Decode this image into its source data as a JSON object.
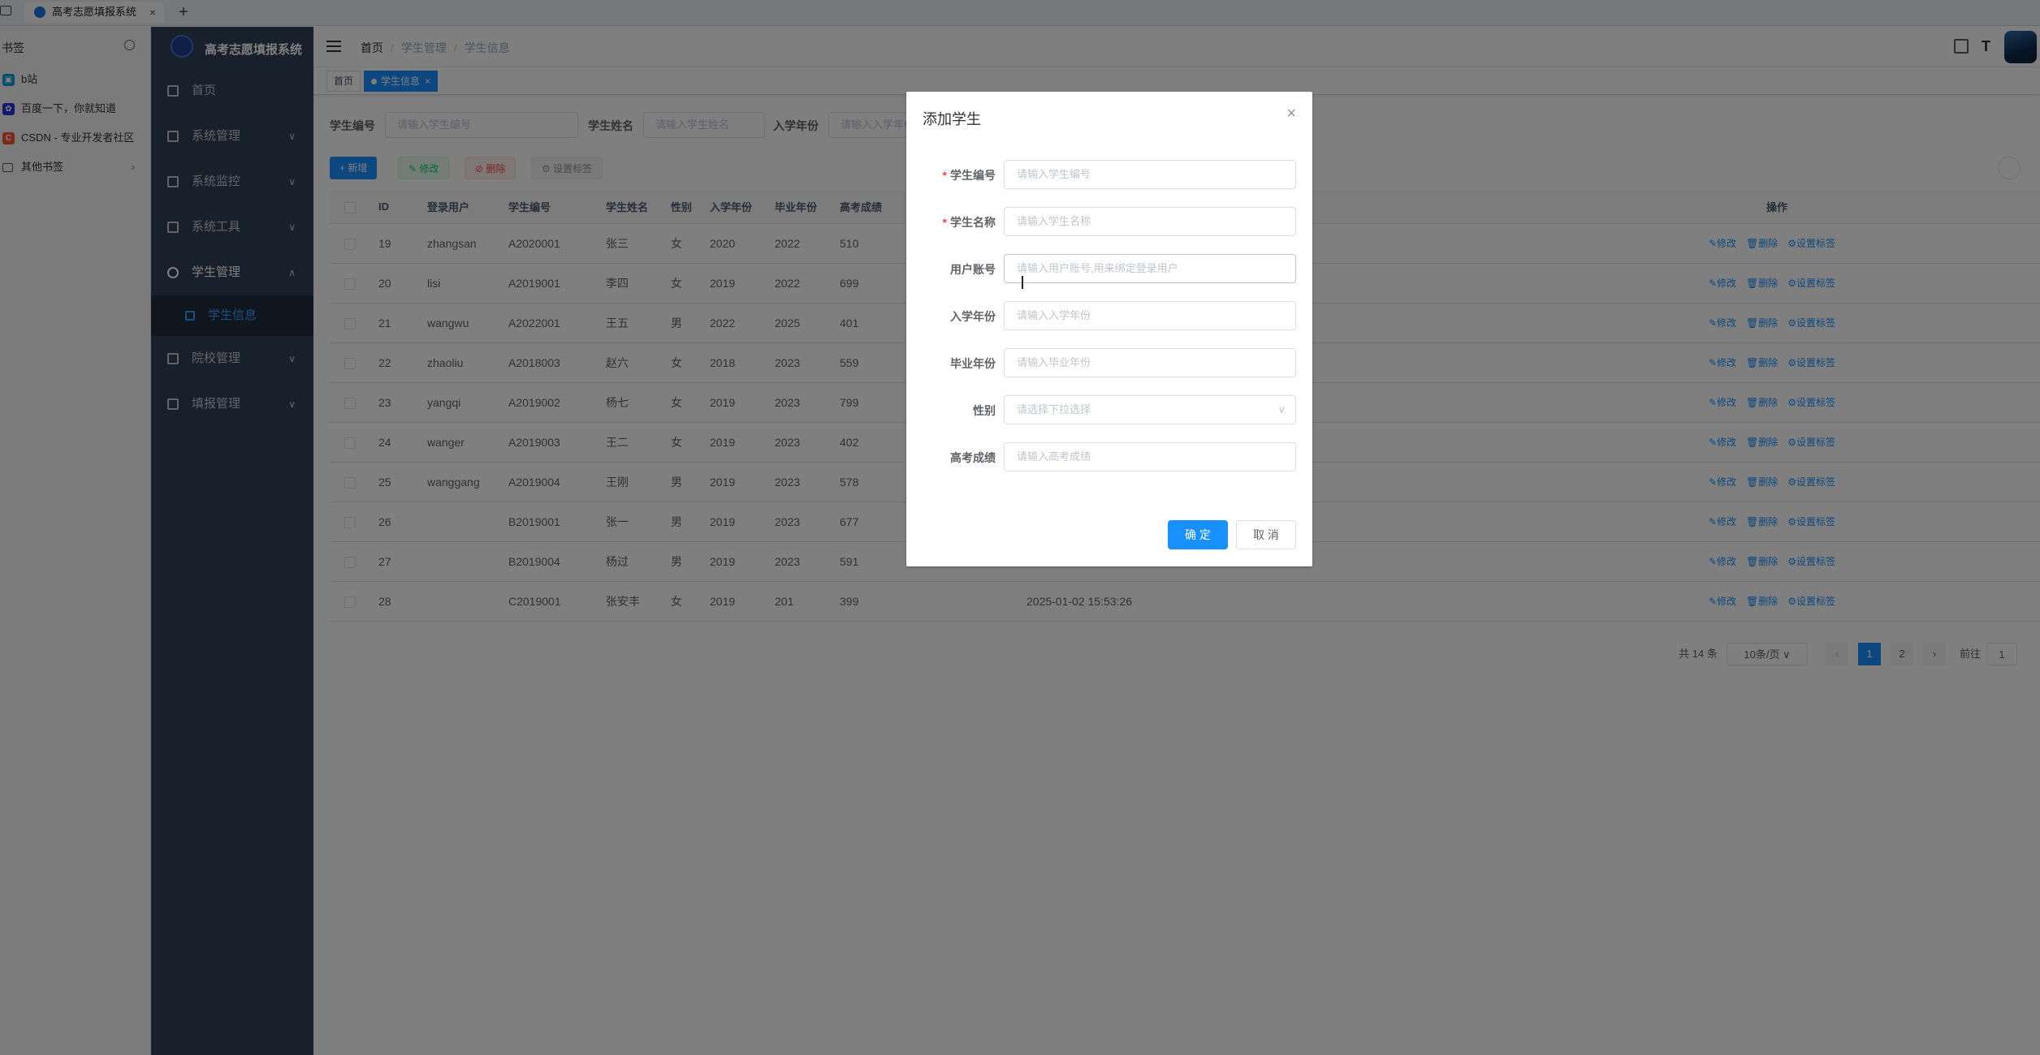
{
  "browser": {
    "tab_title": "高考志愿填报系统",
    "new_tab": "+",
    "close": "×"
  },
  "bookmarks": {
    "title": "书签",
    "items": [
      {
        "label": "b站",
        "icon": "bilibili-icon",
        "color": "#00a1d6"
      },
      {
        "label": "百度一下，你就知道",
        "icon": "baidu-icon",
        "color": "#2932e1"
      },
      {
        "label": "CSDN - 专业开发者社区",
        "icon": "csdn-icon",
        "color": "#fc5531"
      },
      {
        "label": "其他书签",
        "icon": "folder-icon",
        "color": "#5f6368"
      }
    ]
  },
  "app": {
    "logo_text": "高考志愿填报系统",
    "menu": [
      {
        "label": "首页"
      },
      {
        "label": "系统管理"
      },
      {
        "label": "系统监控"
      },
      {
        "label": "系统工具"
      },
      {
        "label": "学生管理"
      },
      {
        "label": "学生信息"
      },
      {
        "label": "院校管理"
      },
      {
        "label": "填报管理"
      }
    ],
    "breadcrumb": [
      "首页",
      "学生管理",
      "学生信息"
    ],
    "tags": [
      "首页",
      "学生信息"
    ],
    "search": {
      "labels": [
        "学生编号",
        "学生姓名",
        "入学年份"
      ],
      "placeholders": [
        "请输入学生编号",
        "请输入学生姓名",
        "请输入入学年份"
      ]
    },
    "toolbar": {
      "add": "+ 新增",
      "edit": "✎ 修改",
      "delete": "⊘ 删除",
      "tags": "⚙ 设置标签"
    },
    "table": {
      "headers": [
        "ID",
        "登录用户",
        "学生编号",
        "学生姓名",
        "性别",
        "入学年份",
        "毕业年份",
        "高考成绩",
        "操作"
      ],
      "rows": [
        [
          "19",
          "zhangsan",
          "A2020001",
          "张三",
          "女",
          "2020",
          "2022",
          "510",
          ""
        ],
        [
          "20",
          "lisi",
          "A2019001",
          "李四",
          "女",
          "2019",
          "2022",
          "699",
          ""
        ],
        [
          "21",
          "wangwu",
          "A2022001",
          "王五",
          "男",
          "2022",
          "2025",
          "401",
          ""
        ],
        [
          "22",
          "zhaoliu",
          "A2018003",
          "赵六",
          "女",
          "2018",
          "2023",
          "559",
          ""
        ],
        [
          "23",
          "yangqi",
          "A2019002",
          "杨七",
          "女",
          "2019",
          "2023",
          "799",
          ""
        ],
        [
          "24",
          "wanger",
          "A2019003",
          "王二",
          "女",
          "2019",
          "2023",
          "402",
          ""
        ],
        [
          "25",
          "wanggang",
          "A2019004",
          "王刚",
          "男",
          "2019",
          "2023",
          "578",
          ""
        ],
        [
          "26",
          "",
          "B2019001",
          "张一",
          "男",
          "2019",
          "2023",
          "677",
          ""
        ],
        [
          "27",
          "",
          "B2019004",
          "杨过",
          "男",
          "2019",
          "2023",
          "591",
          ""
        ],
        [
          "28",
          "",
          "C2019001",
          "张安丰",
          "女",
          "2019",
          "201",
          "399",
          "2025-01-02 15:53:26"
        ]
      ],
      "ops": [
        "✎修改",
        "🗑删除",
        "⚙设置标签"
      ]
    },
    "pagination": {
      "total": "共 14 条",
      "page_size": "10条/页",
      "pages": [
        "1",
        "2"
      ],
      "prev": "‹",
      "next": "›",
      "goto_label": "前往",
      "goto_value": "1"
    }
  },
  "dialog": {
    "title": "添加学生",
    "close": "×",
    "fields": [
      {
        "label": "学生编号",
        "placeholder": "请输入学生编号",
        "required": true
      },
      {
        "label": "学生名称",
        "placeholder": "请输入学生名称",
        "required": true
      },
      {
        "label": "用户账号",
        "placeholder": "请输入用户账号,用来绑定登录用户",
        "required": false
      },
      {
        "label": "入学年份",
        "placeholder": "请输入入学年份",
        "required": false
      },
      {
        "label": "毕业年份",
        "placeholder": "请输入毕业年份",
        "required": false
      },
      {
        "label": "性别",
        "placeholder": "请选择下拉选择",
        "required": false
      },
      {
        "label": "高考成绩",
        "placeholder": "请输入高考成绩",
        "required": false
      }
    ],
    "ok": "确 定",
    "cancel": "取 消"
  },
  "colors": {
    "primary": "#1890ff",
    "sidebar": "#304156",
    "danger": "#ff4949",
    "success": "#13ce66"
  }
}
